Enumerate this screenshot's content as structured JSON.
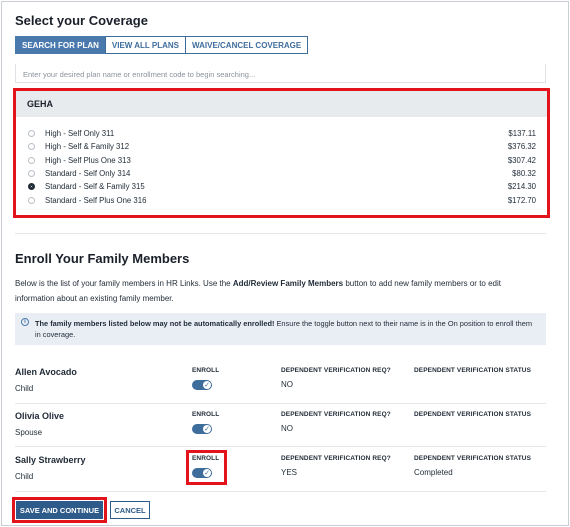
{
  "coverage": {
    "title": "Select your Coverage",
    "tabs": [
      {
        "label": "SEARCH FOR PLAN",
        "active": true
      },
      {
        "label": "VIEW ALL PLANS",
        "active": false
      },
      {
        "label": "WAIVE/CANCEL COVERAGE",
        "active": false
      }
    ],
    "search_placeholder": "Enter your desired plan name or enrollment code to begin searching...",
    "carrier": "GEHA",
    "plans": [
      {
        "name": "High - Self Only 311",
        "price": "$137.11",
        "selected": false
      },
      {
        "name": "High - Self & Family 312",
        "price": "$376.32",
        "selected": false
      },
      {
        "name": "High - Self Plus One 313",
        "price": "$307.42",
        "selected": false
      },
      {
        "name": "Standard - Self Only 314",
        "price": "$80.32",
        "selected": false
      },
      {
        "name": "Standard - Self & Family 315",
        "price": "$214.30",
        "selected": true
      },
      {
        "name": "Standard - Self Plus One 316",
        "price": "$172.70",
        "selected": false
      }
    ]
  },
  "family": {
    "title": "Enroll Your Family Members",
    "intro_pre": "Below is the list of your family members in HR Links. Use the ",
    "intro_bold": "Add/Review Family Members",
    "intro_post": " button to add new family members or to edit information about an existing family member.",
    "info_bold": "The family members listed below may not be automatically enrolled!",
    "info_text": " Ensure the toggle button next to their name is in the On position to enroll them in coverage.",
    "col_enroll": "ENROLL",
    "col_req": "DEPENDENT VERIFICATION REQ?",
    "col_status": "DEPENDENT VERIFICATION STATUS",
    "members": [
      {
        "name": "Allen Avocado",
        "relation": "Child",
        "enrolled": true,
        "verification_req": "NO",
        "verification_status": ""
      },
      {
        "name": "Olivia Olive",
        "relation": "Spouse",
        "enrolled": true,
        "verification_req": "NO",
        "verification_status": ""
      },
      {
        "name": "Sally Strawberry",
        "relation": "Child",
        "enrolled": true,
        "verification_req": "YES",
        "verification_status": "Completed"
      }
    ]
  },
  "actions": {
    "save": "SAVE AND CONTINUE",
    "cancel": "CANCEL"
  },
  "colors": {
    "primary": "#2e5b8a",
    "highlight": "#e3131b",
    "info_bg": "#e9eef5"
  }
}
